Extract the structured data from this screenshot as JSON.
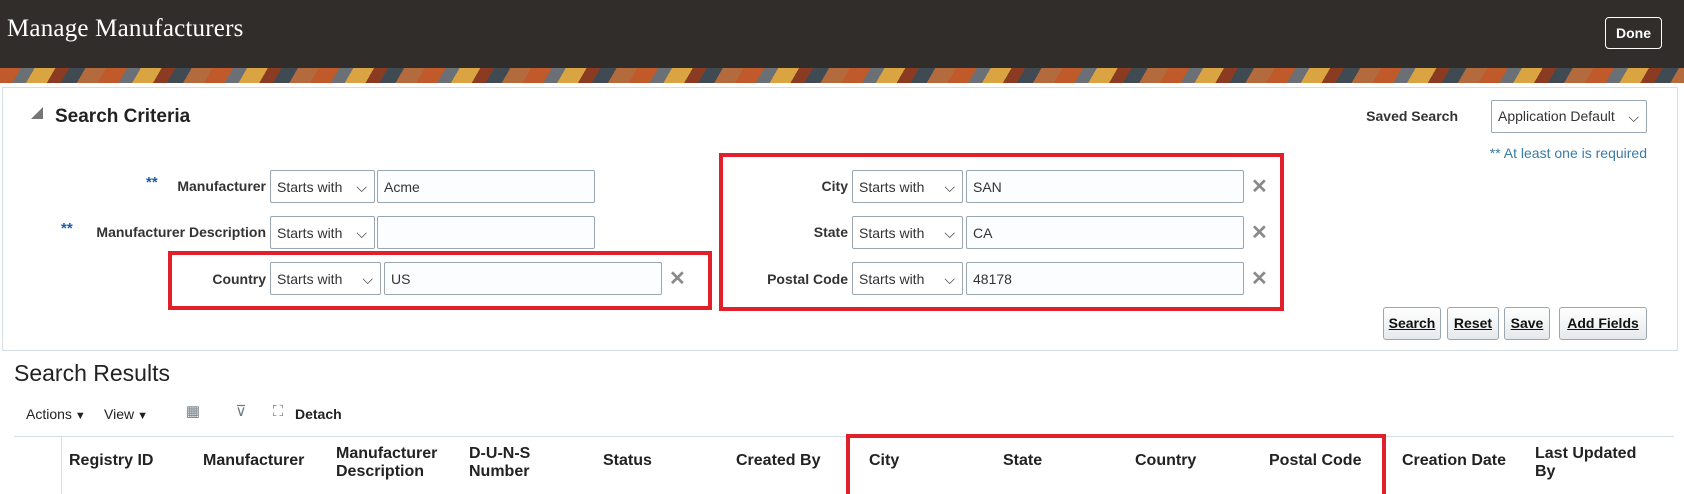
{
  "header": {
    "title": "Manage Manufacturers",
    "done_label": "Done"
  },
  "search": {
    "title": "Search Criteria",
    "saved_search_label": "Saved Search",
    "saved_search_value": "Application Default",
    "required_note": "** At least one is required",
    "required_marker": "**",
    "fields": [
      {
        "label": "Manufacturer",
        "operator": "Starts with",
        "value": "Acme"
      },
      {
        "label": "Manufacturer Description",
        "operator": "Starts with",
        "value": ""
      },
      {
        "label": "Country",
        "operator": "Starts with",
        "value": "US"
      },
      {
        "label": "City",
        "operator": "Starts with",
        "value": "SAN"
      },
      {
        "label": "State",
        "operator": "Starts with",
        "value": "CA"
      },
      {
        "label": "Postal Code",
        "operator": "Starts with",
        "value": "48178"
      }
    ],
    "buttons": {
      "search": "Search",
      "reset": "Reset",
      "save": "Save",
      "add_fields": "Add Fields"
    }
  },
  "results": {
    "title": "Search Results",
    "toolbar": {
      "actions": "Actions",
      "view": "View",
      "detach": "Detach"
    },
    "columns": [
      "Registry ID",
      "Manufacturer",
      "Manufacturer Description",
      "D-U-N-S Number",
      "Status",
      "Created By",
      "City",
      "State",
      "Country",
      "Postal Code",
      "Creation Date",
      "Last Updated By"
    ]
  },
  "colors": {
    "header_bg": "#312d2a",
    "highlight_red": "#e0202a",
    "link_blue": "#3a7ca5"
  }
}
